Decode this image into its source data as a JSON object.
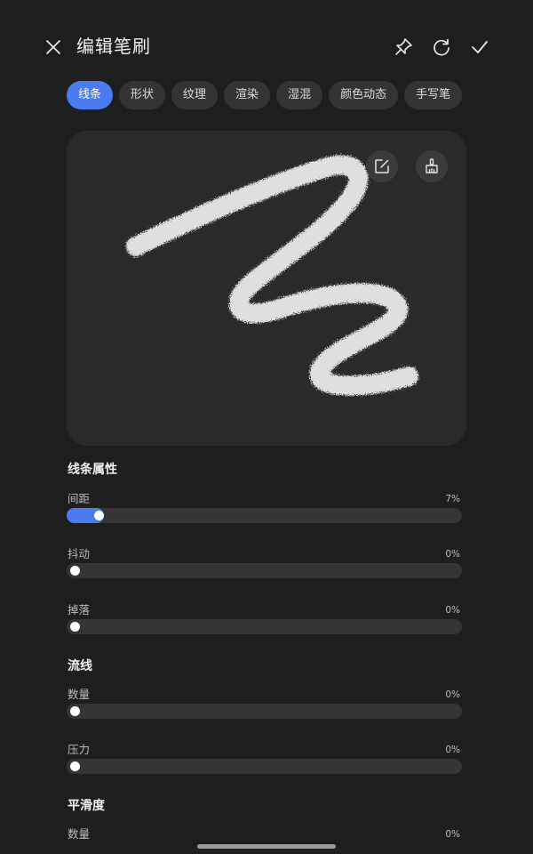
{
  "header": {
    "title": "编辑笔刷",
    "icons": {
      "close": "close-icon",
      "pin": "pin-icon",
      "reset": "reset-icon",
      "confirm": "check-icon"
    }
  },
  "tabs": [
    {
      "label": "线条",
      "active": true
    },
    {
      "label": "形状",
      "active": false
    },
    {
      "label": "纹理",
      "active": false
    },
    {
      "label": "渲染",
      "active": false
    },
    {
      "label": "湿混",
      "active": false
    },
    {
      "label": "颜色动态",
      "active": false
    },
    {
      "label": "手写笔",
      "active": false
    }
  ],
  "preview": {
    "icons": {
      "edit": "edit-icon",
      "brush": "brush-icon"
    }
  },
  "sections": [
    {
      "title": "线条属性",
      "rows": [
        {
          "label": "间距",
          "value": "7%",
          "level": 0.07
        },
        {
          "label": "抖动",
          "value": "0%",
          "level": 0
        },
        {
          "label": "掉落",
          "value": "0%",
          "level": 0
        }
      ]
    },
    {
      "title": "流线",
      "rows": [
        {
          "label": "数量",
          "value": "0%",
          "level": 0
        },
        {
          "label": "压力",
          "value": "0%",
          "level": 0
        }
      ]
    },
    {
      "title": "平滑度",
      "rows": [
        {
          "label": "数量",
          "value": "0%",
          "level": 0
        }
      ]
    }
  ],
  "colors": {
    "accent": "#4a7cf0",
    "background": "#1e1e1f",
    "track": "#353537"
  }
}
